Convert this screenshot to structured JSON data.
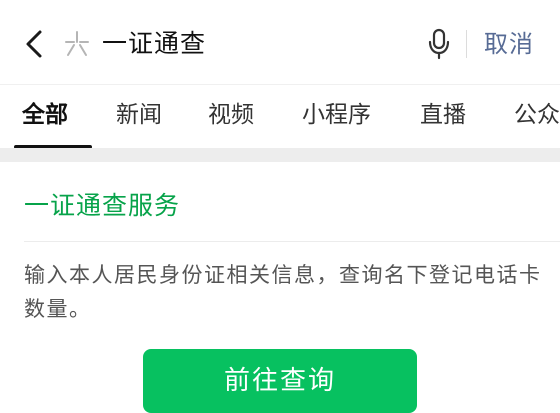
{
  "search": {
    "query": "一证通查",
    "cancel_label": "取消",
    "back_icon": "chevron-left-icon",
    "search_icon": "sparkle-search-icon",
    "mic_icon": "microphone-icon"
  },
  "tabs": [
    {
      "label": "全部",
      "active": true
    },
    {
      "label": "新闻",
      "active": false
    },
    {
      "label": "视频",
      "active": false
    },
    {
      "label": "小程序",
      "active": false
    },
    {
      "label": "直播",
      "active": false
    },
    {
      "label": "公众号",
      "active": false
    }
  ],
  "result": {
    "title": "一证通查服务",
    "description": "输入本人居民身份证相关信息，查询名下登记电话卡数量。",
    "button_label": "前往查询"
  },
  "colors": {
    "accent_green": "#07c160",
    "title_green": "#07a34a",
    "link_blue": "#576b95"
  }
}
